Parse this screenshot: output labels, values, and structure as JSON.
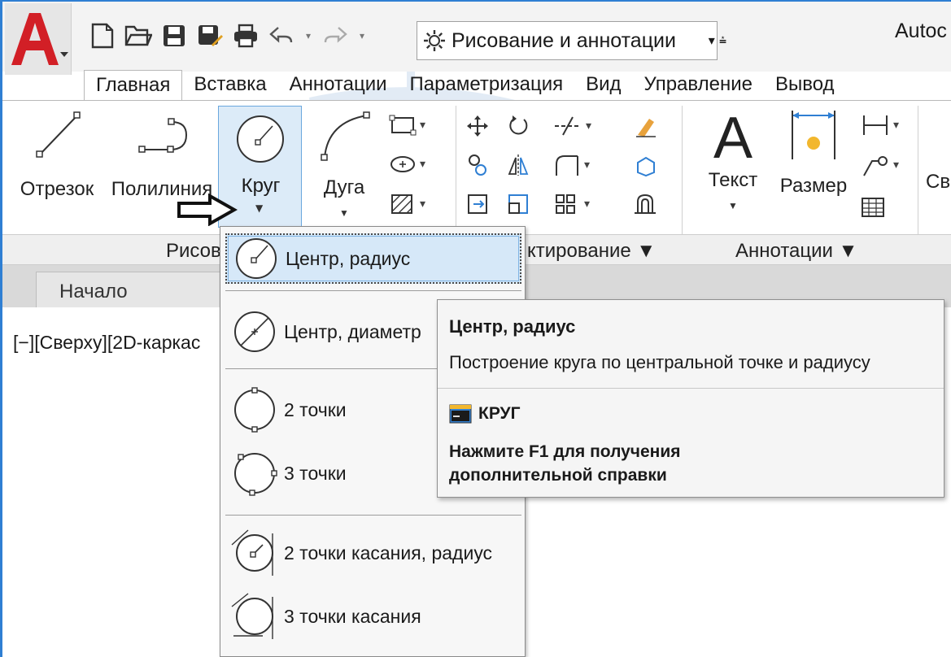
{
  "app": {
    "title": "Autoc",
    "workspace": "Рисование и аннотации"
  },
  "tabs": [
    {
      "label": "Главная",
      "active": true
    },
    {
      "label": "Вставка"
    },
    {
      "label": "Аннотации"
    },
    {
      "label": "Параметризация"
    },
    {
      "label": "Вид"
    },
    {
      "label": "Управление"
    },
    {
      "label": "Вывод"
    }
  ],
  "ribbon": {
    "tools": {
      "line": "Отрезок",
      "polyline": "Полилиния",
      "circle": "Круг",
      "arc": "Дуга",
      "text": "Текст",
      "dimension": "Размер",
      "more": "Св"
    },
    "panels": {
      "draw": "Рисов",
      "modify": "ктирование ▼",
      "annotation": "Аннотации ▼"
    }
  },
  "document": {
    "tab": "Начало",
    "viewport_label": "[−][Сверху][2D-каркас"
  },
  "circle_menu": [
    {
      "label": "Центр, радиус",
      "icon": "circle-center-radius-icon",
      "selected": true
    },
    {
      "label": "Центр, диаметр",
      "icon": "circle-center-diameter-icon"
    },
    {
      "label": "2 точки",
      "icon": "circle-2-points-icon"
    },
    {
      "label": "3 точки",
      "icon": "circle-3-points-icon"
    },
    {
      "label": "2 точки касания, радиус",
      "icon": "circle-tan-tan-radius-icon"
    },
    {
      "label": "3 точки касания",
      "icon": "circle-tan-tan-tan-icon"
    }
  ],
  "tooltip": {
    "title": "Центр, радиус",
    "description": "Построение круга по центральной точке и радиусу",
    "command": "КРУГ",
    "help_line1": "Нажмите F1 для получения",
    "help_line2": "дополнительной справки"
  },
  "colors": {
    "accent": "#2f7fd3",
    "selected_bg": "#d6e8f8",
    "logo_red": "#d21f26"
  }
}
